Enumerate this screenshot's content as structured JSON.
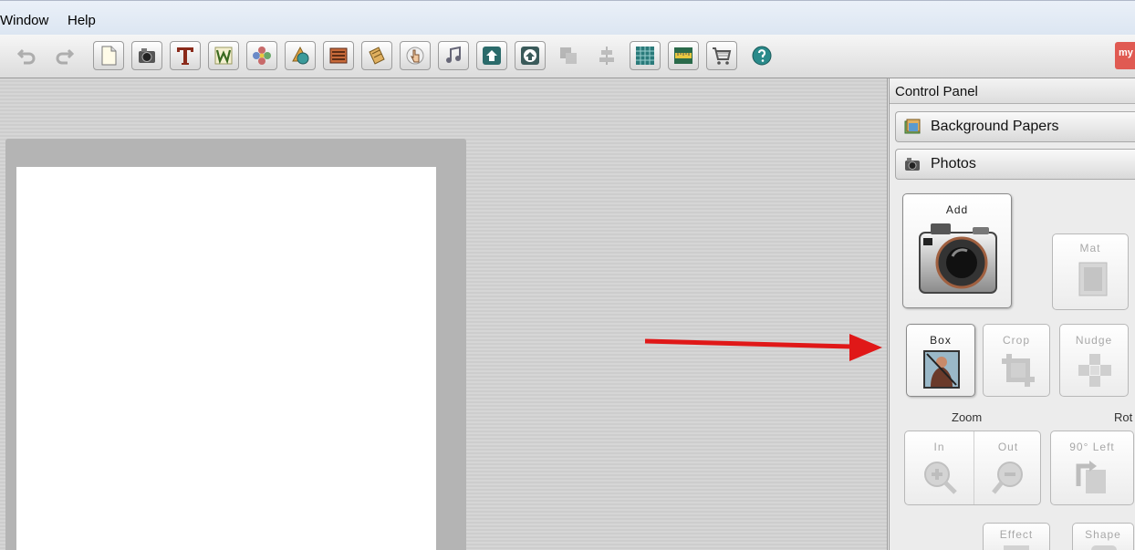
{
  "menu": {
    "window": "Window",
    "help": "Help"
  },
  "toolbar": {
    "buttons": [
      {
        "name": "undo-icon",
        "enabled": false
      },
      {
        "name": "redo-icon",
        "enabled": false
      },
      {
        "name": "new-page-icon",
        "enabled": true
      },
      {
        "name": "camera-icon",
        "enabled": true
      },
      {
        "name": "text-icon",
        "enabled": true
      },
      {
        "name": "word-art-icon",
        "enabled": true
      },
      {
        "name": "flower-embellishment-icon",
        "enabled": true
      },
      {
        "name": "shapes-icon",
        "enabled": true
      },
      {
        "name": "stamp-icon",
        "enabled": true
      },
      {
        "name": "paper-icon",
        "enabled": true
      },
      {
        "name": "finger-icon",
        "enabled": true
      },
      {
        "name": "music-icon",
        "enabled": true
      },
      {
        "name": "bring-front-icon",
        "enabled": true
      },
      {
        "name": "send-back-icon",
        "enabled": true
      },
      {
        "name": "layers-icon",
        "enabled": false
      },
      {
        "name": "align-icon",
        "enabled": false
      },
      {
        "name": "grid-icon",
        "enabled": true
      },
      {
        "name": "ruler-icon",
        "enabled": true
      },
      {
        "name": "cart-icon",
        "enabled": true
      },
      {
        "name": "help-icon",
        "enabled": true
      }
    ],
    "brand_text": "my"
  },
  "control_panel": {
    "title": "Control Panel",
    "sections": {
      "background_papers": "Background Papers",
      "photos": "Photos"
    },
    "photo_buttons": {
      "add": "Add",
      "mat": "Mat",
      "box": "Box",
      "crop": "Crop",
      "nudge": "Nudge",
      "zoom_label": "Zoom",
      "rotate_label": "Rot",
      "zoom_in": "In",
      "zoom_out": "Out",
      "rotate_left": "90° Left",
      "effect": "Effect",
      "shape": "Shape"
    }
  }
}
